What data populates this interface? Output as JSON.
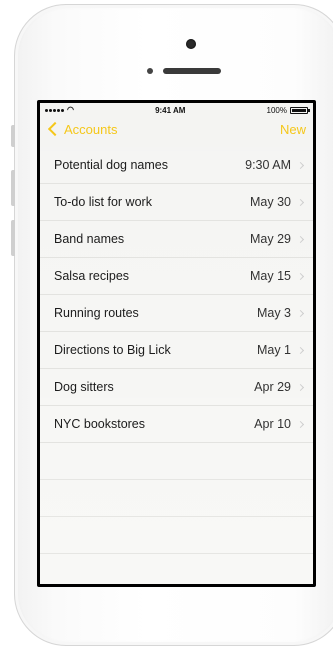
{
  "status_bar": {
    "signal": "•••••",
    "time": "9:41 AM",
    "battery": "100%"
  },
  "nav": {
    "back_label": "Accounts",
    "new_label": "New"
  },
  "notes": [
    {
      "title": "Potential dog names",
      "date": "9:30 AM"
    },
    {
      "title": "To-do list for work",
      "date": "May 30"
    },
    {
      "title": "Band names",
      "date": "May 29"
    },
    {
      "title": "Salsa recipes",
      "date": "May 15"
    },
    {
      "title": "Running routes",
      "date": "May 3"
    },
    {
      "title": "Directions to Big Lick",
      "date": "May 1"
    },
    {
      "title": "Dog sitters",
      "date": "Apr 29"
    },
    {
      "title": "NYC bookstores",
      "date": "Apr 10"
    }
  ],
  "colors": {
    "accent": "#f5c71a",
    "paper": "#f8f8f6"
  }
}
